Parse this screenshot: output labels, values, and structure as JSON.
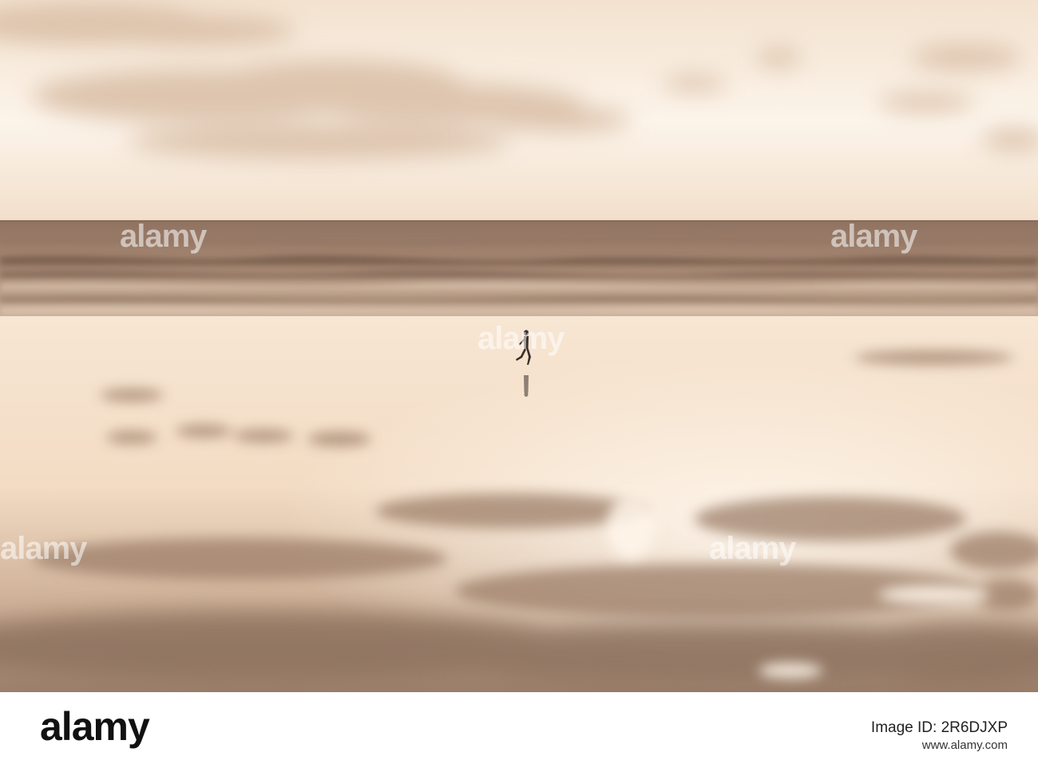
{
  "photo": {
    "subject": "person-running-on-beach",
    "palette": {
      "sky_light": "#fbf1e6",
      "sky_mid": "#f1ddc8",
      "cloud": "#dcc2ab",
      "sea": "#9c7c68",
      "sea_dark": "#6e5343",
      "sand_light": "#f4e0cb",
      "sand_shadow": "#a58973",
      "figure": "#3a2f2a"
    }
  },
  "watermark": {
    "text": "alamy"
  },
  "footer": {
    "logo": "alamy",
    "image_id": "Image ID: 2R6DJXP",
    "url": "www.alamy.com"
  }
}
